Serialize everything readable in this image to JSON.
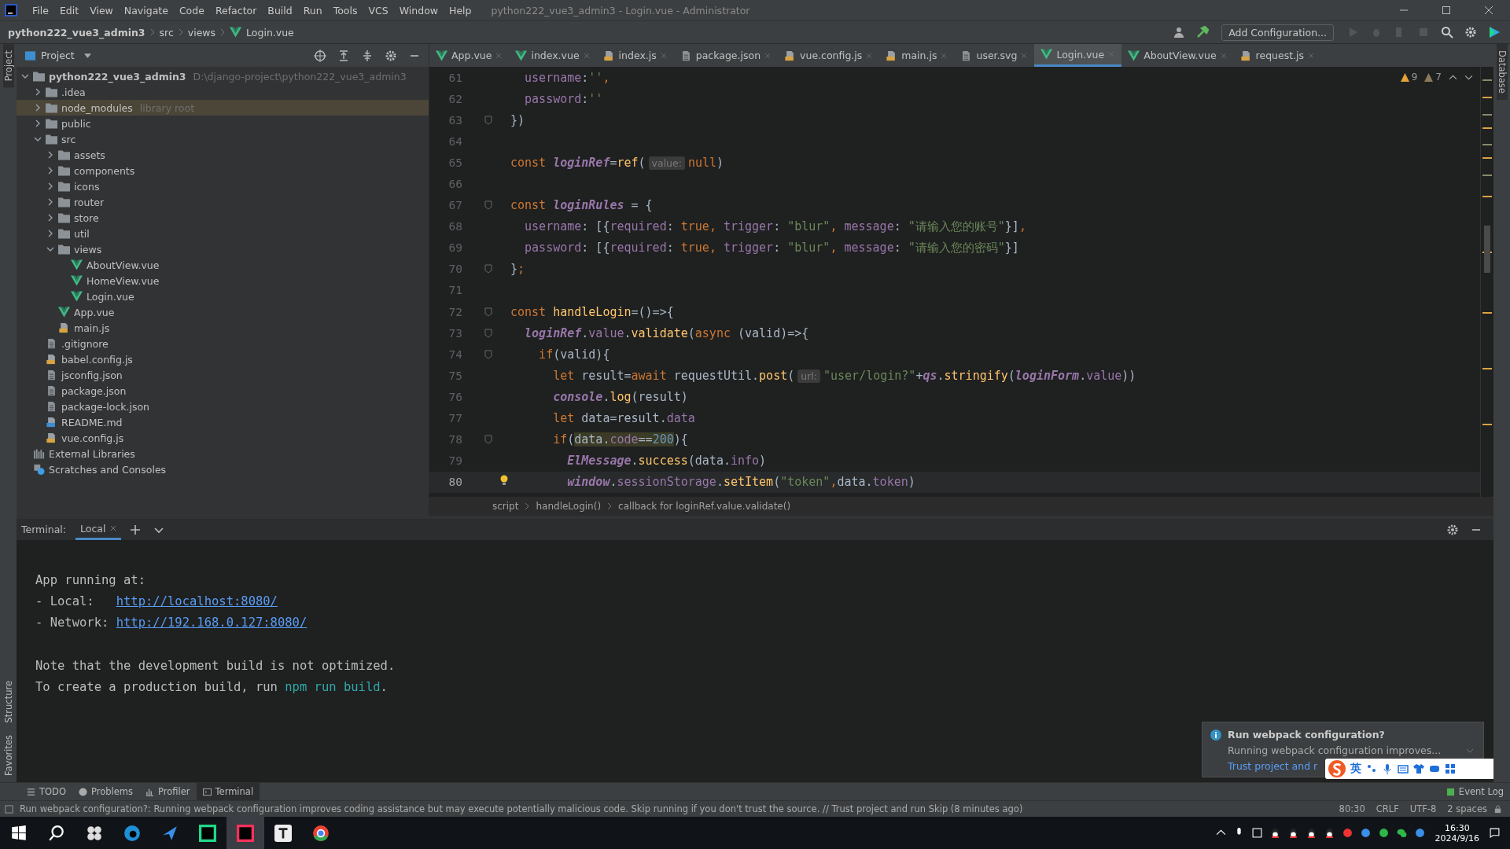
{
  "window": {
    "title": "python222_vue3_admin3 - Login.vue - Administrator"
  },
  "menu": [
    "File",
    "Edit",
    "View",
    "Navigate",
    "Code",
    "Refactor",
    "Build",
    "Run",
    "Tools",
    "VCS",
    "Window",
    "Help"
  ],
  "nav": {
    "crumbs": [
      {
        "text": "python222_vue3_admin3",
        "kind": "project"
      },
      {
        "text": "src",
        "kind": "dir"
      },
      {
        "text": "views",
        "kind": "dir"
      },
      {
        "text": "Login.vue",
        "kind": "vue"
      }
    ],
    "run_config": "Add Configuration..."
  },
  "side_tools_left": [
    "Project",
    "Structure",
    "Favorites"
  ],
  "side_tools_right": [
    "Database"
  ],
  "project_panel": {
    "title": "Project"
  },
  "tree": [
    {
      "name": "python222_vue3_admin3",
      "note": "D:\\django-project\\python222_vue3_admin3",
      "kind": "project",
      "expanded": true,
      "excluded": false,
      "children": [
        {
          "name": ".idea",
          "kind": "folder",
          "expanded": false,
          "excluded": false
        },
        {
          "name": "node_modules",
          "note": "library root",
          "kind": "folder",
          "expanded": false,
          "excluded": true
        },
        {
          "name": "public",
          "kind": "folder",
          "expanded": false,
          "excluded": false
        },
        {
          "name": "src",
          "kind": "folder",
          "expanded": true,
          "excluded": false,
          "children": [
            {
              "name": "assets",
              "kind": "folder",
              "expanded": false,
              "excluded": false
            },
            {
              "name": "components",
              "kind": "folder",
              "expanded": false,
              "excluded": false
            },
            {
              "name": "icons",
              "kind": "folder",
              "expanded": false,
              "excluded": false
            },
            {
              "name": "router",
              "kind": "folder",
              "expanded": false,
              "excluded": false
            },
            {
              "name": "store",
              "kind": "folder",
              "expanded": false,
              "excluded": false
            },
            {
              "name": "util",
              "kind": "folder",
              "expanded": false,
              "excluded": false
            },
            {
              "name": "views",
              "kind": "folder",
              "expanded": true,
              "excluded": false,
              "children": [
                {
                  "name": "AboutView.vue",
                  "kind": "vue"
                },
                {
                  "name": "HomeView.vue",
                  "kind": "vue"
                },
                {
                  "name": "Login.vue",
                  "kind": "vue"
                }
              ]
            },
            {
              "name": "App.vue",
              "kind": "vue"
            },
            {
              "name": "main.js",
              "kind": "js"
            }
          ]
        },
        {
          "name": ".gitignore",
          "kind": "file"
        },
        {
          "name": "babel.config.js",
          "kind": "js"
        },
        {
          "name": "jsconfig.json",
          "kind": "file"
        },
        {
          "name": "package.json",
          "kind": "file"
        },
        {
          "name": "package-lock.json",
          "kind": "file"
        },
        {
          "name": "README.md",
          "kind": "md"
        },
        {
          "name": "vue.config.js",
          "kind": "js"
        }
      ]
    },
    {
      "name": "External Libraries",
      "kind": "library"
    },
    {
      "name": "Scratches and Consoles",
      "kind": "scratch"
    }
  ],
  "tabs": [
    {
      "label": "App.vue",
      "kind": "vue",
      "selected": false
    },
    {
      "label": "index.vue",
      "kind": "vue",
      "selected": false
    },
    {
      "label": "index.js",
      "kind": "js",
      "selected": false
    },
    {
      "label": "package.json",
      "kind": "file",
      "selected": false
    },
    {
      "label": "vue.config.js",
      "kind": "js",
      "selected": false
    },
    {
      "label": "main.js",
      "kind": "js",
      "selected": false
    },
    {
      "label": "user.svg",
      "kind": "file",
      "selected": false
    },
    {
      "label": "Login.vue",
      "kind": "vue",
      "selected": true
    },
    {
      "label": "AboutView.vue",
      "kind": "vue",
      "selected": false
    },
    {
      "label": "request.js",
      "kind": "js",
      "selected": false
    }
  ],
  "inspections": {
    "warnings": "9",
    "weak_warnings": "7"
  },
  "code": [
    {
      "number": "61",
      "fold": false,
      "current": false,
      "tokens": [
        {
          "text": "  username",
          "kind": "field"
        },
        {
          "text": ":",
          "kind": "plain"
        },
        {
          "text": "''",
          "kind": "string"
        },
        {
          "text": ",",
          "kind": "keyword"
        }
      ]
    },
    {
      "number": "62",
      "fold": false,
      "current": false,
      "tokens": [
        {
          "text": "  password",
          "kind": "field"
        },
        {
          "text": ":",
          "kind": "plain"
        },
        {
          "text": "''",
          "kind": "string"
        }
      ]
    },
    {
      "number": "63",
      "fold": true,
      "current": false,
      "tokens": [
        {
          "text": "})",
          "kind": "plain"
        }
      ]
    },
    {
      "number": "64",
      "fold": false,
      "current": false
    },
    {
      "number": "65",
      "fold": false,
      "current": false,
      "tokens": [
        {
          "text": "const ",
          "kind": "keyword"
        },
        {
          "text": "loginRef",
          "kind": "variable"
        },
        {
          "text": "=",
          "kind": "plain"
        },
        {
          "text": "ref",
          "kind": "method"
        },
        {
          "text": "(",
          "kind": "plain"
        },
        {
          "text": "value:",
          "kind": "hint"
        },
        {
          "text": "null",
          "kind": "keyword"
        },
        {
          "text": ")",
          "kind": "plain"
        }
      ]
    },
    {
      "number": "66",
      "fold": false,
      "current": false
    },
    {
      "number": "67",
      "fold": true,
      "current": false,
      "tokens": [
        {
          "text": "const ",
          "kind": "keyword"
        },
        {
          "text": "loginRules",
          "kind": "variable"
        },
        {
          "text": " = {",
          "kind": "plain"
        }
      ]
    },
    {
      "number": "68",
      "fold": false,
      "current": false,
      "tokens": [
        {
          "text": "  username",
          "kind": "field"
        },
        {
          "text": ": [{",
          "kind": "plain"
        },
        {
          "text": "required",
          "kind": "field"
        },
        {
          "text": ": ",
          "kind": "plain"
        },
        {
          "text": "true",
          "kind": "keyword"
        },
        {
          "text": ", ",
          "kind": "keyword"
        },
        {
          "text": "trigger",
          "kind": "field"
        },
        {
          "text": ": ",
          "kind": "plain"
        },
        {
          "text": "\"blur\"",
          "kind": "string"
        },
        {
          "text": ", ",
          "kind": "keyword"
        },
        {
          "text": "message",
          "kind": "field"
        },
        {
          "text": ": ",
          "kind": "plain"
        },
        {
          "text": "\"请输入您的账号\"",
          "kind": "string"
        },
        {
          "text": "}]",
          "kind": "plain"
        },
        {
          "text": ",",
          "kind": "keyword"
        }
      ]
    },
    {
      "number": "69",
      "fold": false,
      "current": false,
      "tokens": [
        {
          "text": "  password",
          "kind": "field"
        },
        {
          "text": ": [{",
          "kind": "plain"
        },
        {
          "text": "required",
          "kind": "field"
        },
        {
          "text": ": ",
          "kind": "plain"
        },
        {
          "text": "true",
          "kind": "keyword"
        },
        {
          "text": ", ",
          "kind": "keyword"
        },
        {
          "text": "trigger",
          "kind": "field"
        },
        {
          "text": ": ",
          "kind": "plain"
        },
        {
          "text": "\"blur\"",
          "kind": "string"
        },
        {
          "text": ", ",
          "kind": "keyword"
        },
        {
          "text": "message",
          "kind": "field"
        },
        {
          "text": ": ",
          "kind": "plain"
        },
        {
          "text": "\"请输入您的密码\"",
          "kind": "string"
        },
        {
          "text": "}]",
          "kind": "plain"
        }
      ]
    },
    {
      "number": "70",
      "fold": true,
      "current": false,
      "tokens": [
        {
          "text": "}",
          "kind": "plain"
        },
        {
          "text": ";",
          "kind": "keyword"
        }
      ]
    },
    {
      "number": "71",
      "fold": false,
      "current": false
    },
    {
      "number": "72",
      "fold": true,
      "current": false,
      "tokens": [
        {
          "text": "const ",
          "kind": "keyword"
        },
        {
          "text": "handleLogin",
          "kind": "method"
        },
        {
          "text": "=()=>{",
          "kind": "plain"
        }
      ]
    },
    {
      "number": "73",
      "fold": true,
      "current": false,
      "tokens": [
        {
          "text": "  loginRef",
          "kind": "variable"
        },
        {
          "text": ".",
          "kind": "plain"
        },
        {
          "text": "value",
          "kind": "field"
        },
        {
          "text": ".",
          "kind": "plain"
        },
        {
          "text": "validate",
          "kind": "method"
        },
        {
          "text": "(",
          "kind": "plain"
        },
        {
          "text": "async ",
          "kind": "keyword"
        },
        {
          "text": "(valid)=>{",
          "kind": "plain"
        }
      ]
    },
    {
      "number": "74",
      "fold": true,
      "current": false,
      "tokens": [
        {
          "text": "    if",
          "kind": "keyword"
        },
        {
          "text": "(valid){",
          "kind": "plain"
        }
      ]
    },
    {
      "number": "75",
      "fold": false,
      "current": false,
      "tokens": [
        {
          "text": "      let ",
          "kind": "keyword"
        },
        {
          "text": "result=",
          "kind": "plain"
        },
        {
          "text": "await ",
          "kind": "keyword"
        },
        {
          "text": "requestUtil.",
          "kind": "plain"
        },
        {
          "text": "post",
          "kind": "method"
        },
        {
          "text": "(",
          "kind": "plain"
        },
        {
          "text": "url:",
          "kind": "hint"
        },
        {
          "text": "\"user/login?\"",
          "kind": "string"
        },
        {
          "text": "+",
          "kind": "plain"
        },
        {
          "text": "qs",
          "kind": "variable"
        },
        {
          "text": ".",
          "kind": "plain"
        },
        {
          "text": "stringify",
          "kind": "method"
        },
        {
          "text": "(",
          "kind": "plain"
        },
        {
          "text": "loginForm",
          "kind": "variable"
        },
        {
          "text": ".",
          "kind": "plain"
        },
        {
          "text": "value",
          "kind": "field"
        },
        {
          "text": "))",
          "kind": "plain"
        }
      ]
    },
    {
      "number": "76",
      "fold": false,
      "current": false,
      "tokens": [
        {
          "text": "      console",
          "kind": "variable"
        },
        {
          "text": ".",
          "kind": "plain"
        },
        {
          "text": "log",
          "kind": "method"
        },
        {
          "text": "(result)",
          "kind": "plain"
        }
      ]
    },
    {
      "number": "77",
      "fold": false,
      "current": false,
      "tokens": [
        {
          "text": "      let ",
          "kind": "keyword"
        },
        {
          "text": "data=result.",
          "kind": "plain"
        },
        {
          "text": "data",
          "kind": "field"
        }
      ]
    },
    {
      "number": "78",
      "fold": true,
      "current": false,
      "tokens": [
        {
          "text": "      if",
          "kind": "keyword"
        },
        {
          "text": "(",
          "kind": "plain"
        },
        {
          "text": "data.",
          "kind": "marked-plain"
        },
        {
          "text": "code",
          "kind": "marked-field"
        },
        {
          "text": "==",
          "kind": "marked-plain"
        },
        {
          "text": "200",
          "kind": "marked-number"
        },
        {
          "text": "){",
          "kind": "plain"
        }
      ]
    },
    {
      "number": "79",
      "fold": false,
      "current": false,
      "tokens": [
        {
          "text": "        ElMessage",
          "kind": "variable"
        },
        {
          "text": ".",
          "kind": "plain"
        },
        {
          "text": "success",
          "kind": "method"
        },
        {
          "text": "(data.",
          "kind": "plain"
        },
        {
          "text": "info",
          "kind": "field"
        },
        {
          "text": ")",
          "kind": "plain"
        }
      ]
    },
    {
      "number": "80",
      "fold": false,
      "current": true,
      "tokens": [
        {
          "text": "        window",
          "kind": "variable"
        },
        {
          "text": ".",
          "kind": "plain"
        },
        {
          "text": "sessionStorage",
          "kind": "field"
        },
        {
          "text": ".",
          "kind": "plain"
        },
        {
          "text": "setItem",
          "kind": "method"
        },
        {
          "text": "(",
          "kind": "plain"
        },
        {
          "text": "\"token\"",
          "kind": "string"
        },
        {
          "text": ",",
          "kind": "keyword"
        },
        {
          "text": "data.",
          "kind": "plain"
        },
        {
          "text": "token",
          "kind": "field"
        },
        {
          "text": ")",
          "kind": "plain"
        }
      ]
    }
  ],
  "editor_breadcrumb": [
    "script",
    "handleLogin()",
    "callback for loginRef.value.validate()"
  ],
  "terminal": {
    "label": "Terminal:",
    "tabs": [
      {
        "label": "Local",
        "selected": true
      }
    ],
    "lines": [
      {
        "kind": "blank"
      },
      {
        "kind": "text",
        "segments": [
          {
            "text": "App running at:",
            "kind": "plain"
          }
        ]
      },
      {
        "kind": "text",
        "segments": [
          {
            "text": "- Local:   ",
            "kind": "plain"
          },
          {
            "text": "http://localhost:8080/",
            "kind": "link"
          }
        ]
      },
      {
        "kind": "text",
        "segments": [
          {
            "text": "- Network: ",
            "kind": "plain"
          },
          {
            "text": "http://192.168.0.127:8080/",
            "kind": "link"
          }
        ]
      },
      {
        "kind": "blank"
      },
      {
        "kind": "text",
        "segments": [
          {
            "text": "Note that the development build is not optimized.",
            "kind": "plain"
          }
        ]
      },
      {
        "kind": "text",
        "segments": [
          {
            "text": "To create a production build, run ",
            "kind": "plain"
          },
          {
            "text": "npm run build",
            "kind": "command"
          },
          {
            "text": ".",
            "kind": "plain"
          }
        ]
      }
    ]
  },
  "notification": {
    "title": "Run webpack configuration?",
    "body": "Running webpack configuration improves...",
    "link": "Trust project and r"
  },
  "ime_toolbar": {
    "mode": "英"
  },
  "tool_tabs": [
    {
      "label": "TODO",
      "kind": "todo",
      "selected": false
    },
    {
      "label": "Problems",
      "kind": "problems",
      "selected": false
    },
    {
      "label": "Profiler",
      "kind": "profiler",
      "selected": false
    },
    {
      "label": "Terminal",
      "kind": "terminal",
      "selected": true
    }
  ],
  "event_log": "Event Log",
  "status_bar": {
    "message": "Run webpack configuration?: Running webpack configuration improves coding assistance but may execute potentially malicious code. Skip running if you don't trust the source. // Trust project and run   Skip (8 minutes ago)",
    "items": [
      "80:30",
      "CRLF",
      "UTF-8",
      "2 spaces"
    ]
  },
  "taskbar": {
    "time": "16:30",
    "date": "2024/9/16"
  }
}
